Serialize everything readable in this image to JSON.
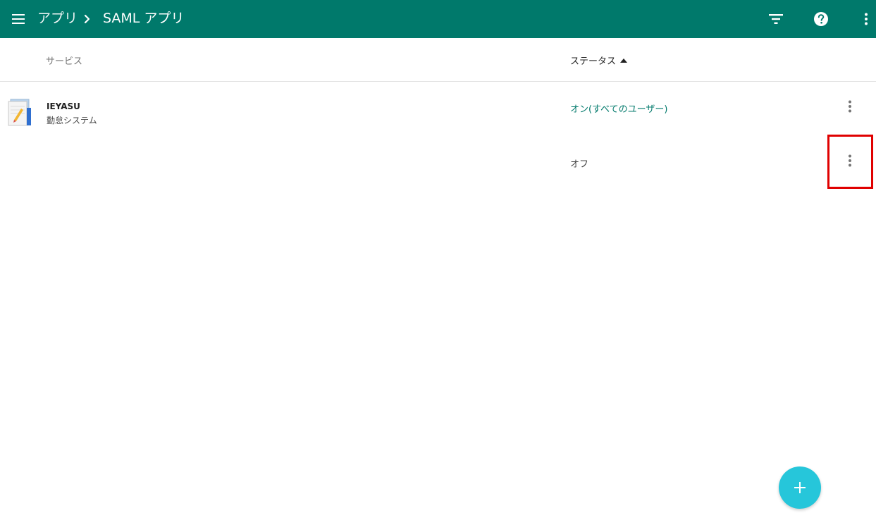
{
  "header": {
    "breadcrumb_root": "アプリ",
    "breadcrumb_current": "SAML アプリ",
    "icons": {
      "menu": "menu-icon",
      "separator": "chevron-right-icon",
      "filter": "filter-icon",
      "help": "help-icon",
      "more": "more-vert-icon"
    }
  },
  "table": {
    "columns": {
      "service": "サービス",
      "status": "ステータス"
    },
    "sort_indicator": "sort-ascending-icon",
    "rows": [
      {
        "name": "IEYASU",
        "description": "勤怠システム",
        "status": "オン(すべてのユーザー)"
      },
      {
        "name": "",
        "description": "",
        "status": "オフ"
      }
    ]
  },
  "fab": {
    "icon": "plus-icon",
    "label": "+"
  },
  "colors": {
    "primary": "#00796b",
    "fab": "#26c6da",
    "highlight": "#e00000",
    "status_on": "#00796b"
  }
}
